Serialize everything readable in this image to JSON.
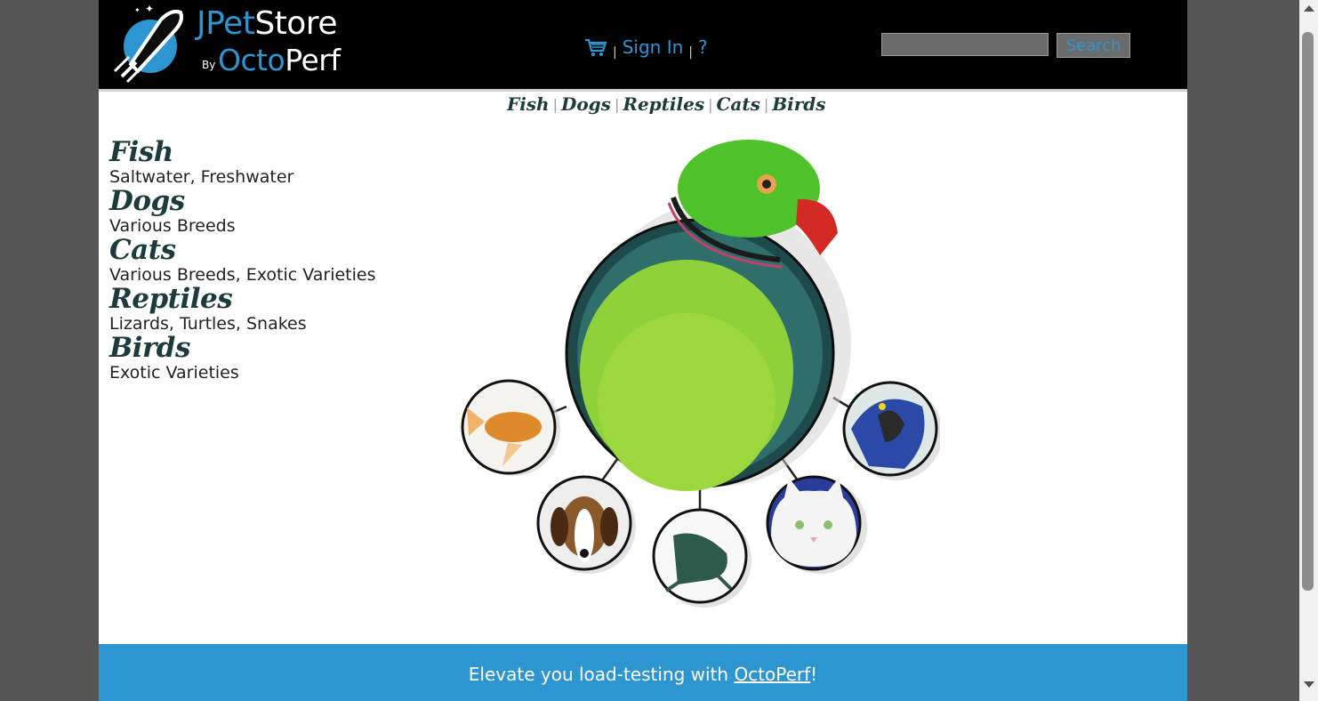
{
  "header": {
    "logo": {
      "jpet": "JPet",
      "store": "Store",
      "by": "By",
      "octo": "Octo",
      "perf": "Perf"
    },
    "menu": {
      "cart_icon": "cart-icon",
      "sign_in": "Sign In",
      "help": "?"
    },
    "search": {
      "value": "",
      "button_label": "Search"
    }
  },
  "quicklinks": [
    "Fish",
    "Dogs",
    "Reptiles",
    "Cats",
    "Birds"
  ],
  "sidebar": {
    "categories": [
      {
        "title": "Fish",
        "desc": "Saltwater, Freshwater"
      },
      {
        "title": "Dogs",
        "desc": "Various Breeds"
      },
      {
        "title": "Cats",
        "desc": "Various Breeds, Exotic Varieties"
      },
      {
        "title": "Reptiles",
        "desc": "Lizards, Turtles, Snakes"
      },
      {
        "title": "Birds",
        "desc": "Exotic Varieties"
      }
    ]
  },
  "main_image": {
    "center": "parrot",
    "orbit": [
      "fish",
      "dog",
      "reptile",
      "cat",
      "bird"
    ]
  },
  "footer": {
    "prefix": "Elevate you load-testing with ",
    "link": "OctoPerf",
    "suffix": "!"
  },
  "colors": {
    "accent": "#2d96d1",
    "header_bg": "#000000",
    "category_text": "#1d3b3c"
  }
}
